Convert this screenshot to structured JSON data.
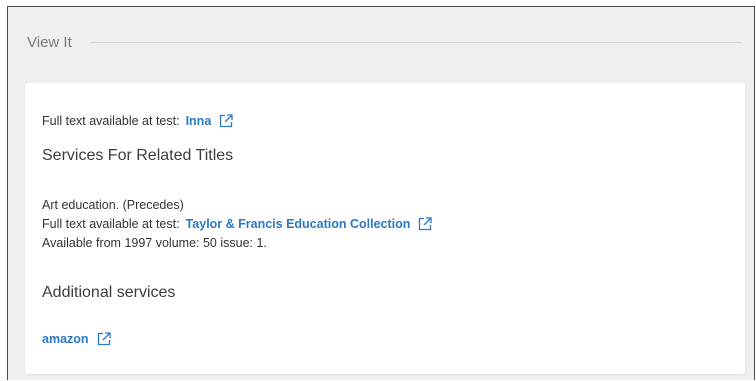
{
  "section": {
    "title": "View It"
  },
  "fulltext_primary": {
    "prefix": "Full text available at test:",
    "link_label": "Inna"
  },
  "related": {
    "heading": "Services For Related Titles",
    "relation_text": "Art education. (Precedes)",
    "prefix": "Full text available at test:",
    "link_label": "Taylor & Francis Education Collection",
    "availability": "Available from 1997 volume: 50 issue: 1."
  },
  "additional": {
    "heading": "Additional services",
    "link_label": "amazon"
  },
  "colors": {
    "link": "#2b79c4",
    "background": "#efefef",
    "card": "#ffffff"
  },
  "icons": {
    "external": "external-link-icon"
  }
}
